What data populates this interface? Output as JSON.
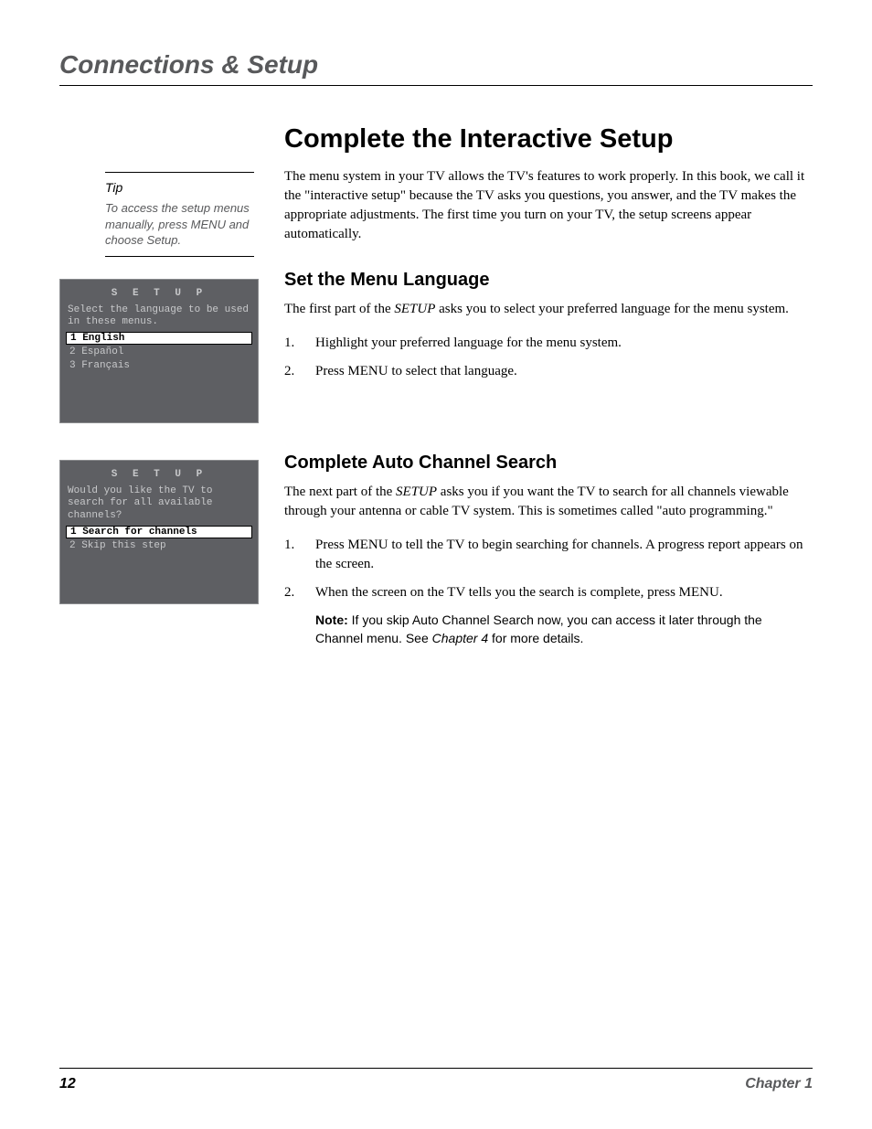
{
  "header": "Connections & Setup",
  "tip": {
    "label": "Tip",
    "text": "To access the setup menus manually, press MENU and choose Setup."
  },
  "screen1": {
    "title": "S E T U P",
    "prompt": "Select the language to be used in these menus.",
    "opt1": "1 English",
    "opt2": "2 Español",
    "opt3": "3 Français"
  },
  "screen2": {
    "title": "S E T U P",
    "prompt": "Would you like the TV to search for all available channels?",
    "opt1": "1 Search for channels",
    "opt2": "2 Skip this step"
  },
  "main": {
    "h1": "Complete the Interactive Setup",
    "p1": "The menu system in your TV allows the TV's features to work properly. In this book, we call it the \"interactive setup\" because the TV asks you questions, you answer, and the TV makes the appropriate adjustments. The first time you turn on your TV, the setup screens appear automatically.",
    "sec1": {
      "h": "Set the Menu Language",
      "p_before": "The first part of the ",
      "p_italic": "SETUP",
      "p_after": " asks you to select your preferred language for the menu system.",
      "li1": "Highlight your preferred language for the menu system.",
      "li2": "Press MENU to select that language."
    },
    "sec2": {
      "h": "Complete Auto Channel Search",
      "p_before": "The next part of the ",
      "p_italic": "SETUP",
      "p_after": " asks you if you want the TV to search for all channels viewable through your antenna or cable TV system. This is sometimes called \"auto programming.\"",
      "li1": "Press MENU to tell the TV to begin searching for channels. A progress report appears on the screen.",
      "li2": "When the screen on the TV tells you the search is complete, press MENU.",
      "note_bold": "Note:",
      "note_a": "  If you skip Auto Channel Search now, you can access it later through the Channel menu. See ",
      "note_i": "Chapter 4",
      "note_b": " for more details."
    }
  },
  "footer": {
    "page": "12",
    "chapter": "Chapter 1"
  }
}
